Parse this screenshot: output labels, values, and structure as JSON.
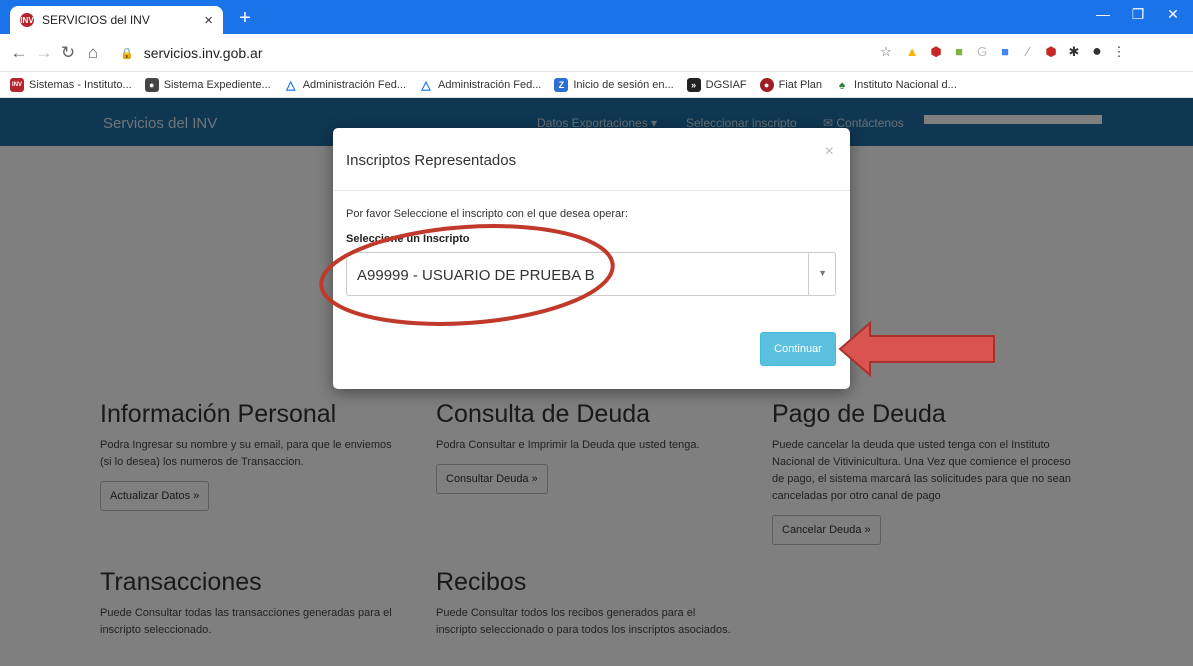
{
  "browser": {
    "tab_title": "SERVICIOS del INV",
    "tab_favicon_text": "INV",
    "url": "servicios.inv.gob.ar",
    "bookmarks": [
      {
        "label": "Sistemas - Instituto...",
        "color": "#b5232c",
        "glyph": "INV"
      },
      {
        "label": "Sistema Expediente...",
        "color": "#444444",
        "glyph": "●"
      },
      {
        "label": "Administración Fed...",
        "color": "#1a73e8",
        "glyph": "△"
      },
      {
        "label": "Administración Fed...",
        "color": "#1a73e8",
        "glyph": "△"
      },
      {
        "label": "Inicio de sesión en...",
        "color": "#2d6fd0",
        "glyph": "Z"
      },
      {
        "label": "DGSIAF",
        "color": "#222222",
        "glyph": "»"
      },
      {
        "label": "Fiat Plan",
        "color": "#a11d24",
        "glyph": "●"
      },
      {
        "label": "Instituto Nacional d...",
        "color": "#2e7d32",
        "glyph": "♠"
      }
    ]
  },
  "site": {
    "brand": "Servicios del INV",
    "nav": {
      "datos": "Datos Exportaciones ▾",
      "seleccionar": "Seleccionar inscripto",
      "contactenos": "✉ Contáctenos"
    }
  },
  "sections": {
    "info": {
      "title": "Información Personal",
      "text": "Podra Ingresar su nombre y su email, para que le enviemos (si lo desea) los numeros de Transaccion.",
      "button": "Actualizar Datos »"
    },
    "consulta": {
      "title": "Consulta de Deuda",
      "text": "Podra Consultar e Imprimir la Deuda que usted tenga.",
      "button": "Consultar Deuda »"
    },
    "pago": {
      "title": "Pago de Deuda",
      "text": "Puede cancelar la deuda que usted tenga con el Instituto Nacional de Vitivinicultura. Una Vez que comience el proceso de pago, el sistema marcará las solicitudes para que no sean canceladas por otro canal de pago",
      "button": "Cancelar Deuda »"
    },
    "transacciones": {
      "title": "Transacciones",
      "text": "Puede Consultar todas las transacciones generadas para el inscripto seleccionado."
    },
    "recibos": {
      "title": "Recibos",
      "text": "Puede Consultar todos los recibos generados para el inscripto seleccionado o para todos los inscriptos asociados."
    }
  },
  "modal": {
    "title": "Inscriptos Representados",
    "close": "×",
    "instruction": "Por favor Seleccione el inscripto con el que desea operar:",
    "select_label": "Seleccione un Inscripto",
    "selected_value": "A99999 - USUARIO DE PRUEBA B",
    "continue_button": "Continuar"
  },
  "colors": {
    "tabbar": "#1a73e8",
    "navbar": "#1f6fa5",
    "continue": "#5bc0de",
    "annotation_red": "#c0392b"
  }
}
